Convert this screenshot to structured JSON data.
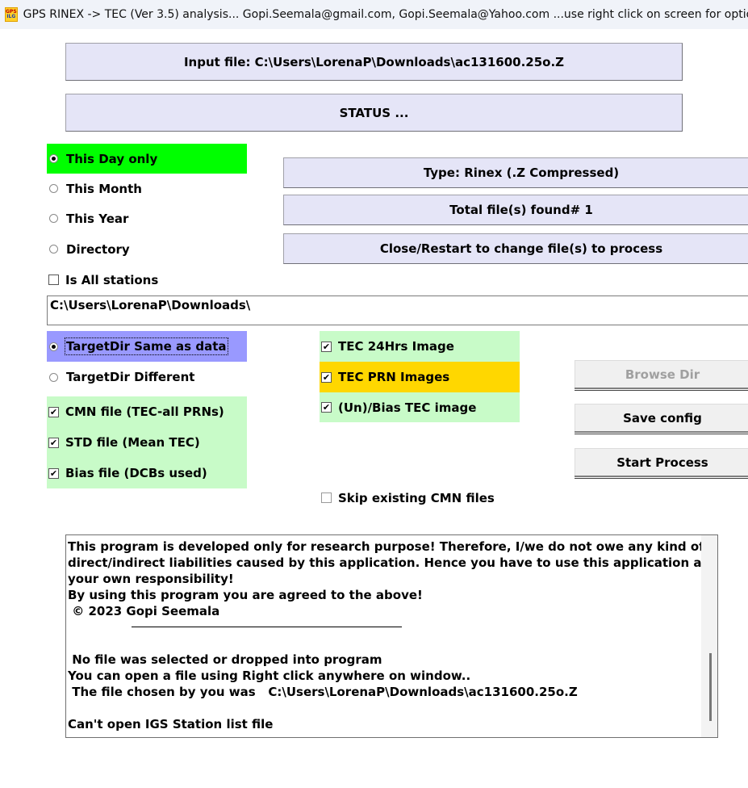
{
  "window": {
    "title": "GPS RINEX -> TEC (Ver 3.5) analysis...  Gopi.Seemala@gmail.com, Gopi.Seemala@Yahoo.com  ...use right click on screen for options",
    "icon_text_top": "GPS",
    "icon_text_bottom": "ILG"
  },
  "panels": {
    "input_file": "Input file: C:\\Users\\LorenaP\\Downloads\\ac131600.25o.Z",
    "status": "STATUS ...",
    "type": "Type: Rinex (.Z Compressed)",
    "total_files": "Total file(s) found#  1",
    "close_restart": "Close/Restart to change file(s) to process"
  },
  "range_options": [
    {
      "label": "This Day only",
      "selected": true
    },
    {
      "label": "This Month",
      "selected": false
    },
    {
      "label": "This Year",
      "selected": false
    },
    {
      "label": "Directory",
      "selected": false
    }
  ],
  "all_stations": {
    "label": "Is All stations",
    "checked": false
  },
  "directory_path": "C:\\Users\\LorenaP\\Downloads\\",
  "target_options": [
    {
      "label": "TargetDir Same as data",
      "selected": true
    },
    {
      "label": "TargetDir Different",
      "selected": false
    }
  ],
  "file_outputs": [
    {
      "label": "CMN file (TEC-all PRNs)",
      "checked": true
    },
    {
      "label": "STD file (Mean TEC)",
      "checked": true
    },
    {
      "label": "Bias file (DCBs used)",
      "checked": true
    }
  ],
  "image_outputs": [
    {
      "label": "TEC 24Hrs Image",
      "checked": true
    },
    {
      "label": "TEC PRN Images",
      "checked": true
    },
    {
      "label": "(Un)/Bias TEC image",
      "checked": true
    }
  ],
  "skip_existing": {
    "label": "Skip existing CMN files",
    "checked": false
  },
  "buttons": {
    "browse_dir": "Browse Dir",
    "save_config": "Save config",
    "start_process": "Start Process"
  },
  "log": {
    "lines": [
      "This program is developed only for research purpose! Therefore, I/we do not owe any kind of",
      "direct/indirect liabilities caused by this application. Hence you have to use this application at",
      "your own responsibility!",
      "By using this program you are agreed to the above!",
      " © 2023 Gopi Seemala",
      "",
      "",
      " No file was selected or dropped into program",
      "You can open a file using Right click anywhere on window..",
      " The file chosen by you was   C:\\Users\\LorenaP\\Downloads\\ac131600.25o.Z",
      "",
      "Can't open IGS Station list file"
    ]
  },
  "colors": {
    "selected_range_bg": "#00ff00",
    "selected_target_bg": "#9999ff",
    "option_group_bg": "#c8fbc8",
    "highlight_prn_bg": "#ffd700",
    "panel_bg": "#e5e5f7"
  },
  "check_mark": "✔"
}
